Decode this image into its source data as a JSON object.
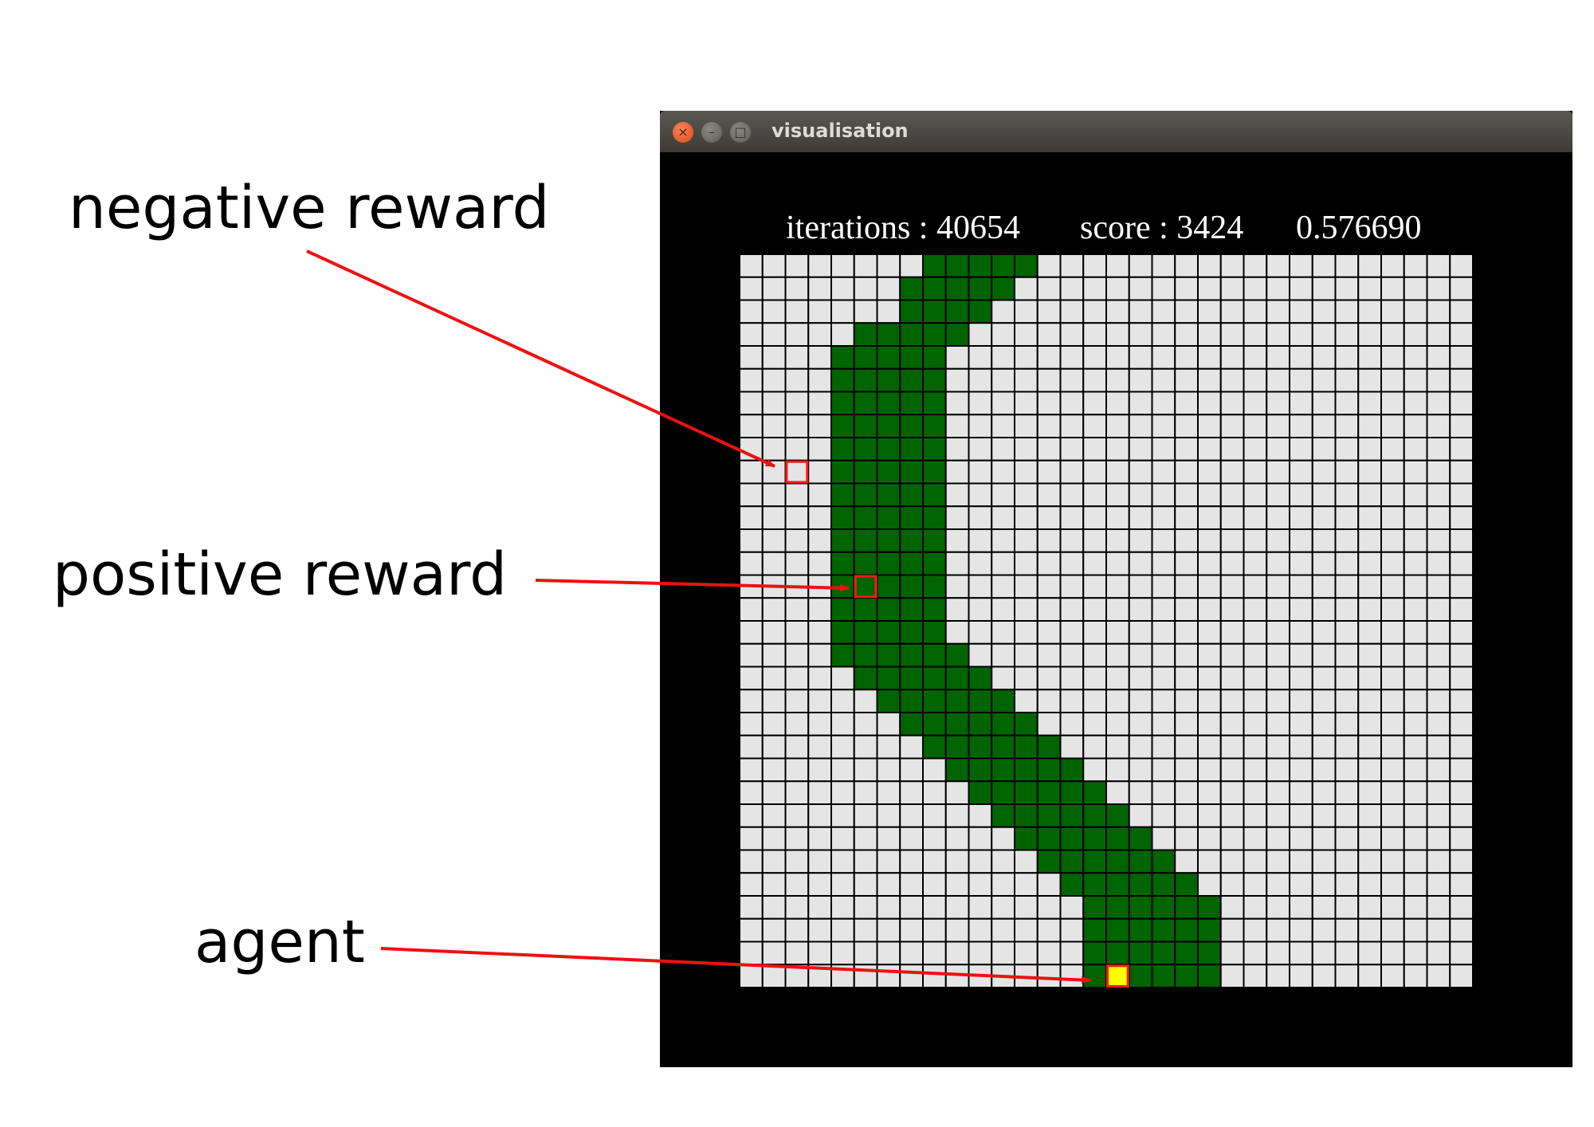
{
  "annotations": {
    "negative": "negative reward",
    "positive": "positive reward",
    "agent": "agent"
  },
  "window": {
    "title": "visualisation",
    "close_glyph": "×",
    "minimize_glyph": "–",
    "maximize_glyph": "□"
  },
  "status": {
    "iterations": "iterations : 40654",
    "score": "score : 3424",
    "ratio": "0.576690"
  },
  "grid": {
    "cols": 32,
    "rows": 32,
    "green_spans": [
      [
        8,
        12
      ],
      [
        7,
        11
      ],
      [
        7,
        10
      ],
      [
        5,
        9
      ],
      [
        4,
        8
      ],
      [
        4,
        8
      ],
      [
        4,
        8
      ],
      [
        4,
        8
      ],
      [
        4,
        8
      ],
      [
        4,
        8
      ],
      [
        4,
        8
      ],
      [
        4,
        8
      ],
      [
        4,
        8
      ],
      [
        4,
        8
      ],
      [
        4,
        8
      ],
      [
        4,
        8
      ],
      [
        4,
        8
      ],
      [
        4,
        9
      ],
      [
        5,
        10
      ],
      [
        6,
        11
      ],
      [
        7,
        12
      ],
      [
        8,
        13
      ],
      [
        9,
        14
      ],
      [
        10,
        15
      ],
      [
        11,
        16
      ],
      [
        12,
        17
      ],
      [
        13,
        18
      ],
      [
        14,
        19
      ],
      [
        15,
        20
      ],
      [
        15,
        20
      ],
      [
        15,
        20
      ],
      [
        15,
        20
      ]
    ],
    "negative_reward_cell": {
      "col": 2,
      "row": 9
    },
    "positive_reward_cell": {
      "col": 5,
      "row": 14
    },
    "agent_cell": {
      "col": 16,
      "row": 31
    }
  },
  "colors": {
    "grid_empty": "#e5e5e5",
    "grid_green": "#006400",
    "grid_line": "#000000",
    "reward_marker": "#ff1a1a",
    "agent_fill": "#ffff00",
    "arrow": "#ee1111",
    "window_bg": "#000000"
  }
}
